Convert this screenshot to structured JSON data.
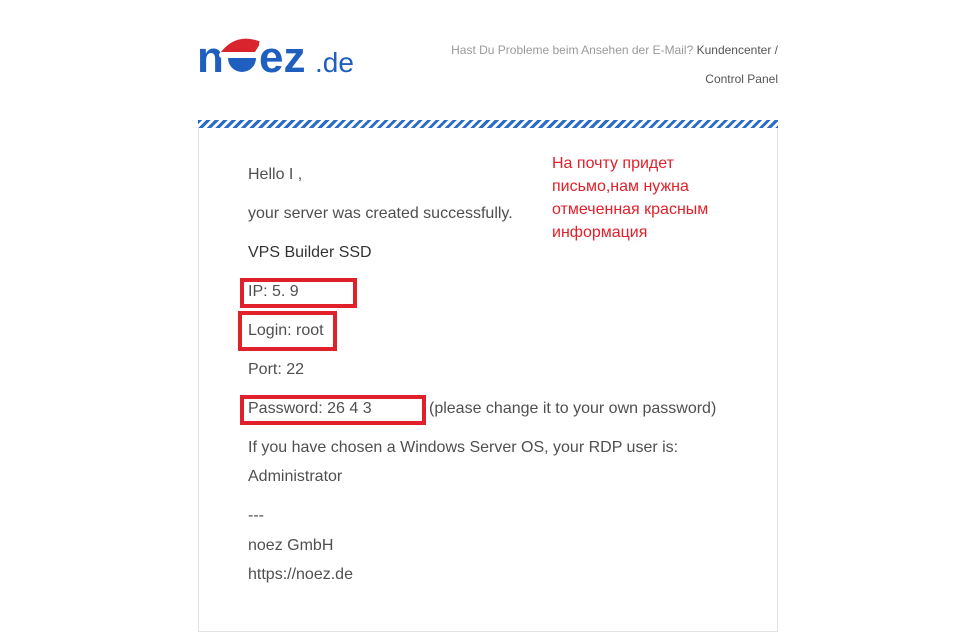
{
  "header": {
    "logo_text": "noez.de",
    "problem_hint": "Hast Du Probleme beim Ansehen der E-Mail?",
    "kundencenter_link": "Kundencenter /",
    "control_panel_link": "Control Panel",
    "colors": {
      "brand_blue": "#1f5fbf",
      "accent_red": "#d9232d"
    }
  },
  "email": {
    "greeting": "Hello I      ,",
    "intro": "your server was created successfully.",
    "product": "VPS Builder SSD",
    "ip": "IP: 5.           9",
    "login": "Login: root",
    "port": "Port: 22",
    "password": "Password: 26    4    3",
    "password_note": "(please change it to your own password)",
    "rdp_text": "If you have chosen a Windows Server OS, your RDP user is:",
    "rdp_user": "Administrator",
    "separator": "---",
    "company": "noez GmbH",
    "website": "https://noez.de"
  },
  "annotation": {
    "lines": [
      "На почту придет",
      "письмо,нам нужна",
      "отмеченная красным",
      "информация"
    ],
    "color": "#e0202a"
  }
}
